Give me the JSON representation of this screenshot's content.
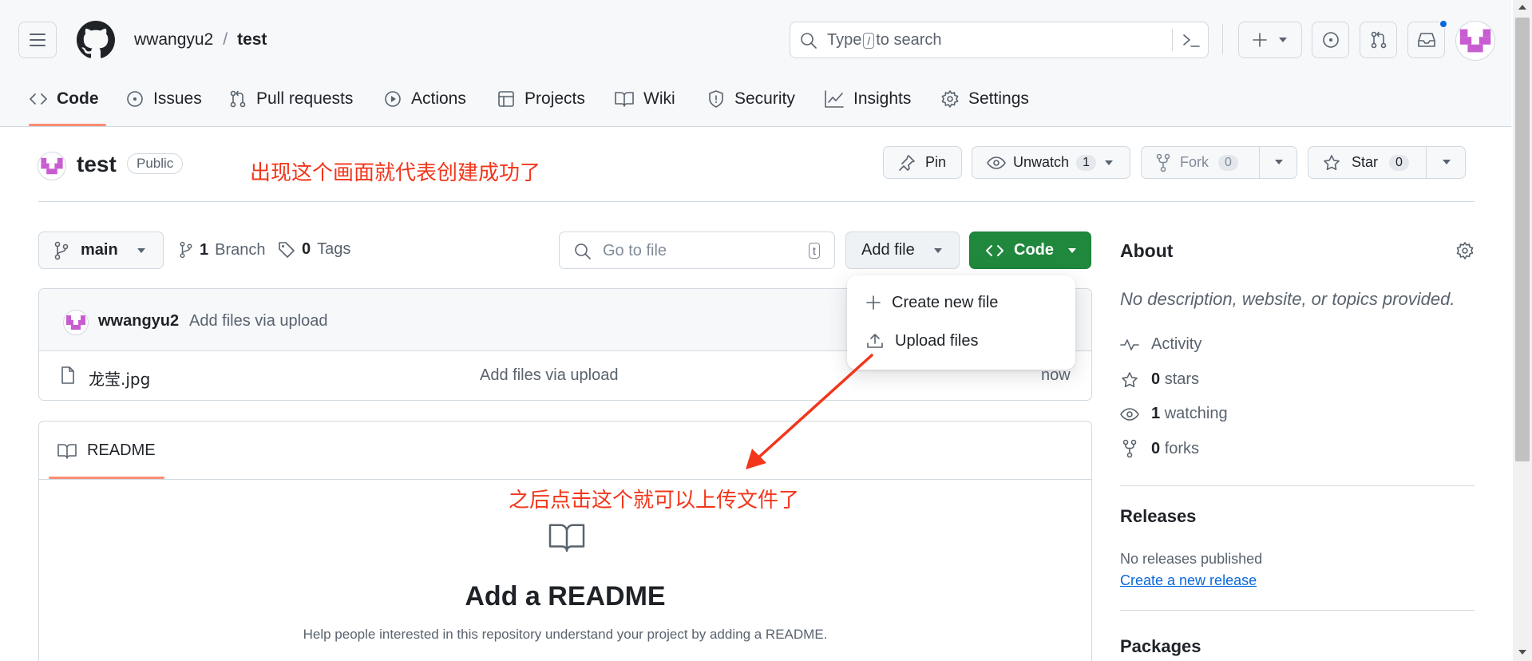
{
  "header": {
    "owner": "wwangyu2",
    "separator": "/",
    "repo": "test",
    "search": {
      "prefix": "Type",
      "key": "/",
      "suffix": "to search"
    }
  },
  "tabs": [
    {
      "label": "Code",
      "icon": "code-icon"
    },
    {
      "label": "Issues",
      "icon": "issue-icon"
    },
    {
      "label": "Pull requests",
      "icon": "pull-request-icon"
    },
    {
      "label": "Actions",
      "icon": "play-icon"
    },
    {
      "label": "Projects",
      "icon": "table-icon"
    },
    {
      "label": "Wiki",
      "icon": "book-icon"
    },
    {
      "label": "Security",
      "icon": "shield-icon"
    },
    {
      "label": "Insights",
      "icon": "graph-icon"
    },
    {
      "label": "Settings",
      "icon": "gear-icon"
    }
  ],
  "repo_header": {
    "name": "test",
    "visibility": "Public",
    "annotation": "出现这个画面就代表创建成功了",
    "pin": "Pin",
    "unwatch": "Unwatch",
    "watch_count": "1",
    "fork": "Fork",
    "fork_count": "0",
    "star": "Star",
    "star_count": "0"
  },
  "toolbar": {
    "branch": "main",
    "branch_count": "1",
    "branch_label": "Branch",
    "tag_count": "0",
    "tag_label": "Tags",
    "goto_placeholder": "Go to file",
    "goto_key": "t",
    "add_file": "Add file",
    "code": "Code"
  },
  "dropdown": {
    "create": "Create new file",
    "upload": "Upload files"
  },
  "commit": {
    "author": "wwangyu2",
    "message": "Add files via upload"
  },
  "files": [
    {
      "name": "龙莹.jpg",
      "message": "Add files via upload",
      "time": "now"
    }
  ],
  "readme": {
    "tab": "README",
    "annotation": "之后点击这个就可以上传文件了",
    "title": "Add a README",
    "desc": "Help people interested in this repository understand your project by adding a README."
  },
  "about": {
    "title": "About",
    "description": "No description, website, or topics provided.",
    "activity": "Activity",
    "stars_count": "0",
    "stars_label": "stars",
    "watching_count": "1",
    "watching_label": "watching",
    "forks_count": "0",
    "forks_label": "forks"
  },
  "releases": {
    "title": "Releases",
    "none": "No releases published",
    "create": "Create a new release"
  },
  "packages": {
    "title": "Packages"
  },
  "colors": {
    "primary_green": "#1f883d",
    "annotation_red": "#f2361b",
    "tab_underline": "#fd8c73",
    "link_blue": "#0969da"
  }
}
